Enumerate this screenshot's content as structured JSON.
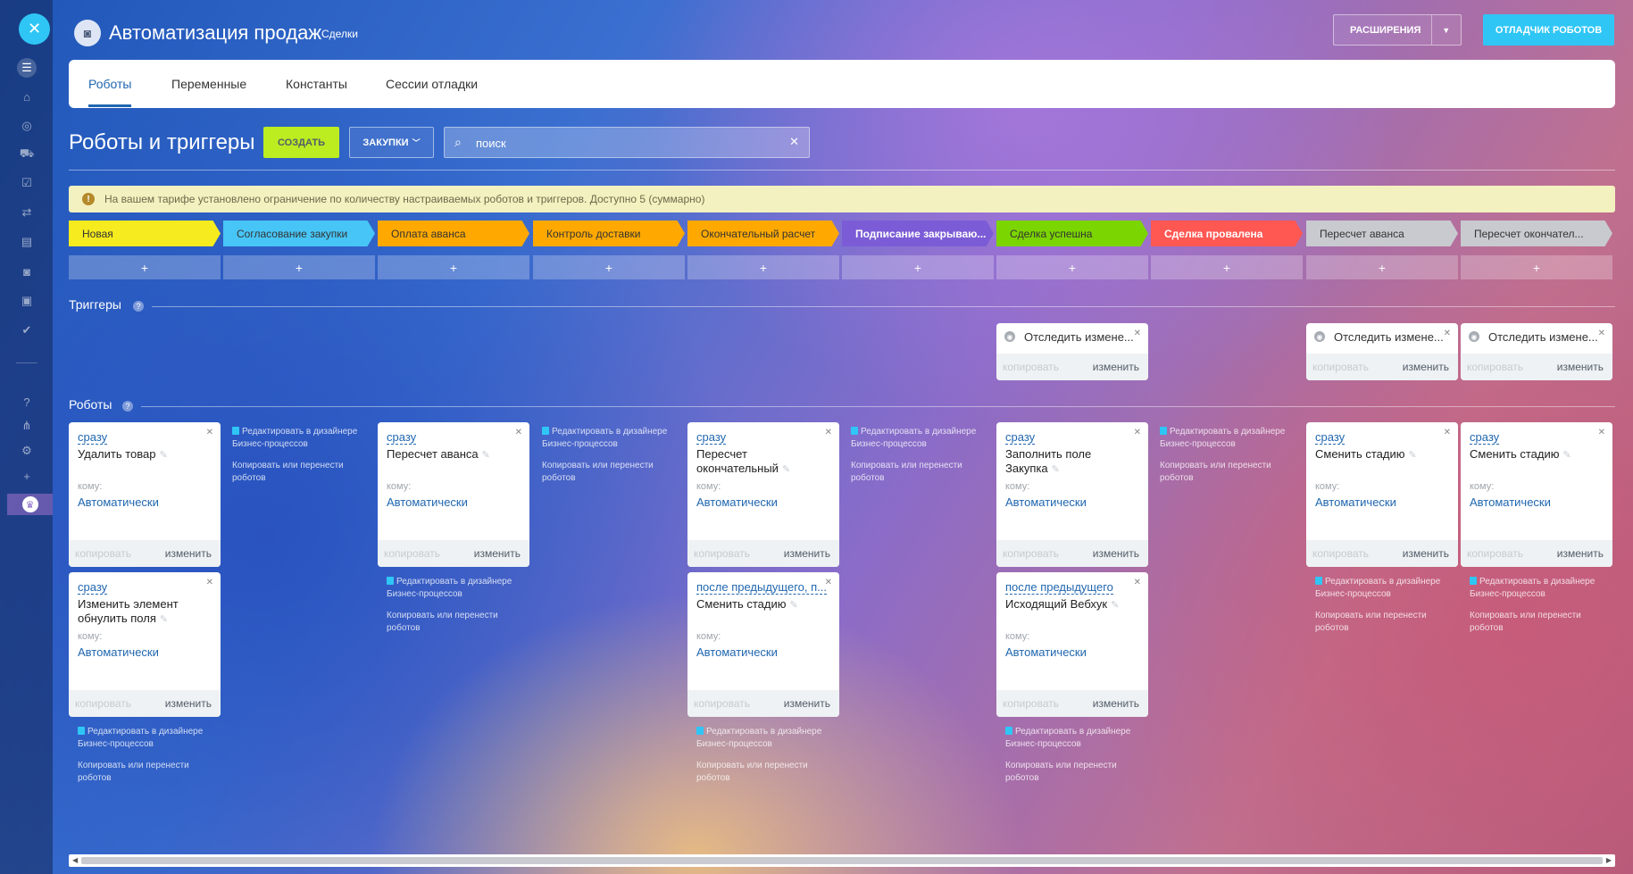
{
  "header": {
    "title": "Автоматизация продаж",
    "subtitle": "Сделки",
    "extensions_label": "РАСШИРЕНИЯ",
    "debugger_label": "ОТЛАДЧИК РОБОТОВ"
  },
  "tabs": [
    "Роботы",
    "Переменные",
    "Константы",
    "Сессии отладки"
  ],
  "toolbar": {
    "title": "Роботы и триггеры",
    "create_label": "СОЗДАТЬ",
    "purchases_label": "ЗАКУПКИ",
    "search_placeholder": "поиск"
  },
  "alert": "На вашем тарифе установлено ограничение по количеству настраиваемых роботов и триггеров. Доступно 5 (суммарно)",
  "stages": [
    {
      "name": "Новая",
      "color": "#f5eb1e",
      "text": "#333"
    },
    {
      "name": "Согласование закупки",
      "color": "#47c5f6",
      "text": "#333"
    },
    {
      "name": "Оплата аванса",
      "color": "#ffa900",
      "text": "#333"
    },
    {
      "name": "Контроль доставки",
      "color": "#ffa900",
      "text": "#333"
    },
    {
      "name": "Окончательный расчет",
      "color": "#ffa900",
      "text": "#333"
    },
    {
      "name": "Подписание закрываю...",
      "color": "#7b5cd6",
      "text": "#fff"
    },
    {
      "name": "Сделка успешна",
      "color": "#7bd500",
      "text": "#333"
    },
    {
      "name": "Сделка провалена",
      "color": "#ff5752",
      "text": "#fff"
    },
    {
      "name": "Пересчет аванса",
      "color": "#c8cacf",
      "text": "#333"
    },
    {
      "name": "Пересчет окончател...",
      "color": "#c8cacf",
      "text": "#333"
    }
  ],
  "plus_label": "+",
  "triggers_title": "Триггеры",
  "robots_title": "Роботы",
  "help_icon": "?",
  "trigger_card": {
    "title": "Отследить измене...",
    "copy": "копировать",
    "edit": "изменить"
  },
  "robot_common": {
    "to": "кому:",
    "auto": "Автоматически",
    "copy": "копировать",
    "edit": "изменить"
  },
  "designer_link": {
    "edit": "Редактировать в дизайнере Бизнес-процессов",
    "copy_move": "Копировать или перенести роботов"
  },
  "robots": [
    {
      "delay": "сразу",
      "name": "Удалить товар"
    },
    {
      "delay": "сразу",
      "name": "Изменить элемент обнулить поля"
    },
    {
      "delay": "сразу",
      "name": "Пересчет аванса"
    },
    {
      "delay": "сразу",
      "name": "Пересчет окончательный"
    },
    {
      "delay": "после предыдущего, п...",
      "name": "Сменить стадию"
    },
    {
      "delay": "сразу",
      "name": "Заполнить поле Закупка"
    },
    {
      "delay": "после предыдущего",
      "name": "Исходящий Вебхук"
    },
    {
      "delay": "сразу",
      "name": "Сменить стадию"
    },
    {
      "delay": "сразу",
      "name": "Сменить стадию"
    }
  ],
  "icons": [
    "close-icon",
    "filter-icon",
    "bank-icon",
    "target-icon",
    "cart-icon",
    "task-icon",
    "flow-icon",
    "contact-icon",
    "robot-icon",
    "box-icon",
    "check-icon",
    "help-icon",
    "org-icon",
    "settings-icon",
    "plus-icon",
    "crown-icon"
  ]
}
